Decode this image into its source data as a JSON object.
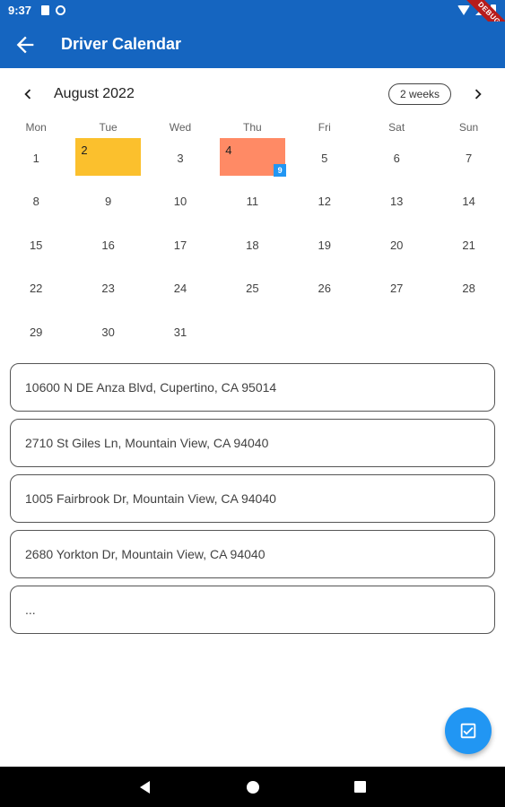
{
  "status_bar": {
    "time": "9:37",
    "debug_label": "DEBUG",
    "icons": [
      "sd-card-icon",
      "sync-icon",
      "wifi-icon",
      "signal-icon",
      "battery-icon"
    ]
  },
  "app_bar": {
    "title": "Driver Calendar",
    "back_icon": "arrow-back-icon",
    "color": "#1565c0"
  },
  "calendar": {
    "month_label": "August 2022",
    "format_button": "2 weeks",
    "weekdays": [
      "Mon",
      "Tue",
      "Wed",
      "Thu",
      "Fri",
      "Sat",
      "Sun"
    ],
    "weeks": [
      [
        "1",
        "2",
        "3",
        "4",
        "5",
        "6",
        "7"
      ],
      [
        "8",
        "9",
        "10",
        "11",
        "12",
        "13",
        "14"
      ],
      [
        "15",
        "16",
        "17",
        "18",
        "19",
        "20",
        "21"
      ],
      [
        "22",
        "23",
        "24",
        "25",
        "26",
        "27",
        "28"
      ],
      [
        "29",
        "30",
        "31",
        "",
        "",
        "",
        ""
      ]
    ],
    "highlighted_days": [
      {
        "day": "2",
        "color": "#fbc02d",
        "badge": ""
      },
      {
        "day": "4",
        "color": "#ff8a65",
        "badge": "9"
      }
    ],
    "badge_color": "#2196f3"
  },
  "addresses": [
    "10600 N DE Anza Blvd, Cupertino, CA 95014",
    "2710 St Giles Ln, Mountain View, CA 94040",
    "1005 Fairbrook Dr, Mountain View, CA 94040",
    "2680 Yorkton Dr, Mountain View, CA 94040",
    "..."
  ],
  "fab": {
    "icon": "check-box-icon",
    "color": "#2196f3"
  },
  "nav_bar": {
    "icons": [
      "nav-back-icon",
      "nav-home-icon",
      "nav-recents-icon"
    ]
  }
}
